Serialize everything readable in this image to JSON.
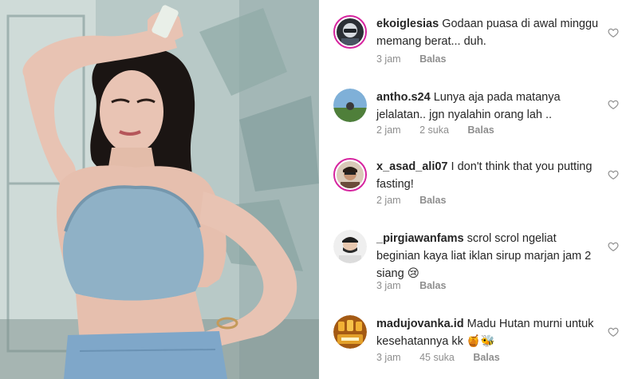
{
  "photo": {
    "alt_subject": "woman-in-denim-top"
  },
  "comments": [
    {
      "username": "ekoiglesias",
      "text": "Godaan puasa di awal minggu memang berat... duh.",
      "time": "3 jam",
      "likes": "",
      "reply_label": "Balas",
      "avatar_ring": true
    },
    {
      "username": "antho.s24",
      "text": "Lunya aja pada matanya jelalatan.. jgn nyalahin orang lah ..",
      "time": "2 jam",
      "likes": "2 suka",
      "reply_label": "Balas",
      "avatar_ring": false
    },
    {
      "username": "x_asad_ali07",
      "text": "I don't think that you putting fasting!",
      "time": "2 jam",
      "likes": "",
      "reply_label": "Balas",
      "avatar_ring": true
    },
    {
      "username": "_pirgiawanfams",
      "text": "scrol scrol ngeliat beginian kaya liat iklan sirup marjan jam 2 siang 😢",
      "time": "3 jam",
      "likes": "",
      "reply_label": "Balas",
      "avatar_ring": false
    },
    {
      "username": "madujovanka.id",
      "text": "Madu Hutan murni untuk kesehatannya kk 🍯🐝",
      "time": "3 jam",
      "likes": "45 suka",
      "reply_label": "Balas",
      "avatar_ring": false
    }
  ],
  "colors": {
    "text": "#262626",
    "meta": "#8e8e8e",
    "story_ring": "#d6249f"
  }
}
